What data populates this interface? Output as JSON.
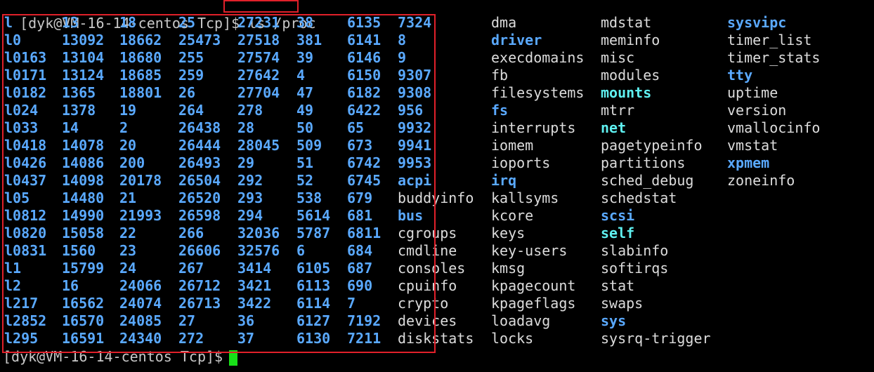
{
  "terminal": {
    "prompt_top": "[dyk@VM-16-14-centos Tcp]$ ",
    "command": "ls /proc",
    "prompt_bottom": "[dyk@VM-16-14-centos Tcp]$ ",
    "accent_highlight": "#e0202a",
    "cursor_color": "#18e018"
  },
  "columns": [
    {
      "items": [
        [
          "l",
          "num"
        ],
        [
          "l0",
          "num"
        ],
        [
          "l0163",
          "num"
        ],
        [
          "l0171",
          "num"
        ],
        [
          "l0182",
          "num"
        ],
        [
          "l024",
          "num"
        ],
        [
          "l033",
          "num"
        ],
        [
          "l0418",
          "num"
        ],
        [
          "l0426",
          "num"
        ],
        [
          "l0437",
          "num"
        ],
        [
          "l05",
          "num"
        ],
        [
          "l0812",
          "num"
        ],
        [
          "l0820",
          "num"
        ],
        [
          "l0831",
          "num"
        ],
        [
          "l1",
          "num"
        ],
        [
          "l2",
          "num"
        ],
        [
          "l217",
          "num"
        ],
        [
          "l2852",
          "num"
        ],
        [
          "l295",
          "num"
        ]
      ]
    },
    {
      "items": [
        [
          "13",
          "num"
        ],
        [
          "13092",
          "num"
        ],
        [
          "13104",
          "num"
        ],
        [
          "13124",
          "num"
        ],
        [
          "1365",
          "num"
        ],
        [
          "1378",
          "num"
        ],
        [
          "14",
          "num"
        ],
        [
          "14078",
          "num"
        ],
        [
          "14086",
          "num"
        ],
        [
          "14098",
          "num"
        ],
        [
          "14480",
          "num"
        ],
        [
          "14990",
          "num"
        ],
        [
          "15058",
          "num"
        ],
        [
          "1560",
          "num"
        ],
        [
          "15799",
          "num"
        ],
        [
          "16",
          "num"
        ],
        [
          "16562",
          "num"
        ],
        [
          "16570",
          "num"
        ],
        [
          "16591",
          "num"
        ]
      ]
    },
    {
      "items": [
        [
          "18",
          "num"
        ],
        [
          "18662",
          "num"
        ],
        [
          "18680",
          "num"
        ],
        [
          "18685",
          "num"
        ],
        [
          "18801",
          "num"
        ],
        [
          "19",
          "num"
        ],
        [
          "2",
          "num"
        ],
        [
          "20",
          "num"
        ],
        [
          "200",
          "num"
        ],
        [
          "20178",
          "num"
        ],
        [
          "21",
          "num"
        ],
        [
          "21993",
          "num"
        ],
        [
          "22",
          "num"
        ],
        [
          "23",
          "num"
        ],
        [
          "24",
          "num"
        ],
        [
          "24066",
          "num"
        ],
        [
          "24074",
          "num"
        ],
        [
          "24085",
          "num"
        ],
        [
          "24340",
          "num"
        ]
      ]
    },
    {
      "items": [
        [
          "25",
          "num"
        ],
        [
          "25473",
          "num"
        ],
        [
          "255",
          "num"
        ],
        [
          "259",
          "num"
        ],
        [
          "26",
          "num"
        ],
        [
          "264",
          "num"
        ],
        [
          "26438",
          "num"
        ],
        [
          "26444",
          "num"
        ],
        [
          "26493",
          "num"
        ],
        [
          "26504",
          "num"
        ],
        [
          "26520",
          "num"
        ],
        [
          "26598",
          "num"
        ],
        [
          "266",
          "num"
        ],
        [
          "26606",
          "num"
        ],
        [
          "267",
          "num"
        ],
        [
          "26712",
          "num"
        ],
        [
          "26713",
          "num"
        ],
        [
          "27",
          "num"
        ],
        [
          "272",
          "num"
        ]
      ]
    },
    {
      "items": [
        [
          "27231",
          "num"
        ],
        [
          "27518",
          "num"
        ],
        [
          "27574",
          "num"
        ],
        [
          "27642",
          "num"
        ],
        [
          "27704",
          "num"
        ],
        [
          "278",
          "num"
        ],
        [
          "28",
          "num"
        ],
        [
          "28045",
          "num"
        ],
        [
          "29",
          "num"
        ],
        [
          "292",
          "num"
        ],
        [
          "293",
          "num"
        ],
        [
          "294",
          "num"
        ],
        [
          "32036",
          "num"
        ],
        [
          "32576",
          "num"
        ],
        [
          "3414",
          "num"
        ],
        [
          "3421",
          "num"
        ],
        [
          "3422",
          "num"
        ],
        [
          "36",
          "num"
        ],
        [
          "37",
          "num"
        ]
      ]
    },
    {
      "items": [
        [
          "38",
          "num"
        ],
        [
          "381",
          "num"
        ],
        [
          "39",
          "num"
        ],
        [
          "4",
          "num"
        ],
        [
          "47",
          "num"
        ],
        [
          "49",
          "num"
        ],
        [
          "50",
          "num"
        ],
        [
          "509",
          "num"
        ],
        [
          "51",
          "num"
        ],
        [
          "52",
          "num"
        ],
        [
          "538",
          "num"
        ],
        [
          "5614",
          "num"
        ],
        [
          "5787",
          "num"
        ],
        [
          "6",
          "num"
        ],
        [
          "6105",
          "num"
        ],
        [
          "6113",
          "num"
        ],
        [
          "6114",
          "num"
        ],
        [
          "6127",
          "num"
        ],
        [
          "6130",
          "num"
        ]
      ]
    },
    {
      "items": [
        [
          "6135",
          "num"
        ],
        [
          "6141",
          "num"
        ],
        [
          "6146",
          "num"
        ],
        [
          "6150",
          "num"
        ],
        [
          "6182",
          "num"
        ],
        [
          "6422",
          "num"
        ],
        [
          "65",
          "num"
        ],
        [
          "673",
          "num"
        ],
        [
          "6742",
          "num"
        ],
        [
          "6745",
          "num"
        ],
        [
          "679",
          "num"
        ],
        [
          "681",
          "num"
        ],
        [
          "6811",
          "num"
        ],
        [
          "684",
          "num"
        ],
        [
          "687",
          "num"
        ],
        [
          "690",
          "num"
        ],
        [
          "7",
          "num"
        ],
        [
          "7192",
          "num"
        ],
        [
          "7211",
          "num"
        ]
      ]
    },
    {
      "items": [
        [
          "7324",
          "num"
        ],
        [
          "8",
          "num"
        ],
        [
          "9",
          "num"
        ],
        [
          "9307",
          "num"
        ],
        [
          "9308",
          "num"
        ],
        [
          "956",
          "num"
        ],
        [
          "9932",
          "num"
        ],
        [
          "9941",
          "num"
        ],
        [
          "9953",
          "num"
        ],
        [
          "acpi",
          "dir"
        ],
        [
          "buddyinfo",
          "file"
        ],
        [
          "bus",
          "dir"
        ],
        [
          "cgroups",
          "file"
        ],
        [
          "cmdline",
          "file"
        ],
        [
          "consoles",
          "file"
        ],
        [
          "cpuinfo",
          "file"
        ],
        [
          "crypto",
          "file"
        ],
        [
          "devices",
          "file"
        ],
        [
          "diskstats",
          "file"
        ]
      ]
    },
    {
      "items": [
        [
          "dma",
          "file"
        ],
        [
          "driver",
          "dir"
        ],
        [
          "execdomains",
          "file"
        ],
        [
          "fb",
          "file"
        ],
        [
          "filesystems",
          "file"
        ],
        [
          "fs",
          "dir"
        ],
        [
          "interrupts",
          "file"
        ],
        [
          "iomem",
          "file"
        ],
        [
          "ioports",
          "file"
        ],
        [
          "irq",
          "dir"
        ],
        [
          "kallsyms",
          "file"
        ],
        [
          "kcore",
          "file"
        ],
        [
          "keys",
          "file"
        ],
        [
          "key-users",
          "file"
        ],
        [
          "kmsg",
          "file"
        ],
        [
          "kpagecount",
          "file"
        ],
        [
          "kpageflags",
          "file"
        ],
        [
          "loadavg",
          "file"
        ],
        [
          "locks",
          "file"
        ]
      ]
    },
    {
      "items": [
        [
          "mdstat",
          "file"
        ],
        [
          "meminfo",
          "file"
        ],
        [
          "misc",
          "file"
        ],
        [
          "modules",
          "file"
        ],
        [
          "mounts",
          "link"
        ],
        [
          "mtrr",
          "file"
        ],
        [
          "net",
          "link"
        ],
        [
          "pagetypeinfo",
          "file"
        ],
        [
          "partitions",
          "file"
        ],
        [
          "sched_debug",
          "file"
        ],
        [
          "schedstat",
          "file"
        ],
        [
          "scsi",
          "dir"
        ],
        [
          "self",
          "link"
        ],
        [
          "slabinfo",
          "file"
        ],
        [
          "softirqs",
          "file"
        ],
        [
          "stat",
          "file"
        ],
        [
          "swaps",
          "file"
        ],
        [
          "sys",
          "dir"
        ],
        [
          "sysrq-trigger",
          "file"
        ]
      ]
    },
    {
      "items": [
        [
          "sysvipc",
          "dir"
        ],
        [
          "timer_list",
          "file"
        ],
        [
          "timer_stats",
          "file"
        ],
        [
          "tty",
          "dir"
        ],
        [
          "uptime",
          "file"
        ],
        [
          "version",
          "file"
        ],
        [
          "vmallocinfo",
          "file"
        ],
        [
          "vmstat",
          "file"
        ],
        [
          "xpmem",
          "dir"
        ],
        [
          "zoneinfo",
          "file"
        ]
      ]
    }
  ]
}
